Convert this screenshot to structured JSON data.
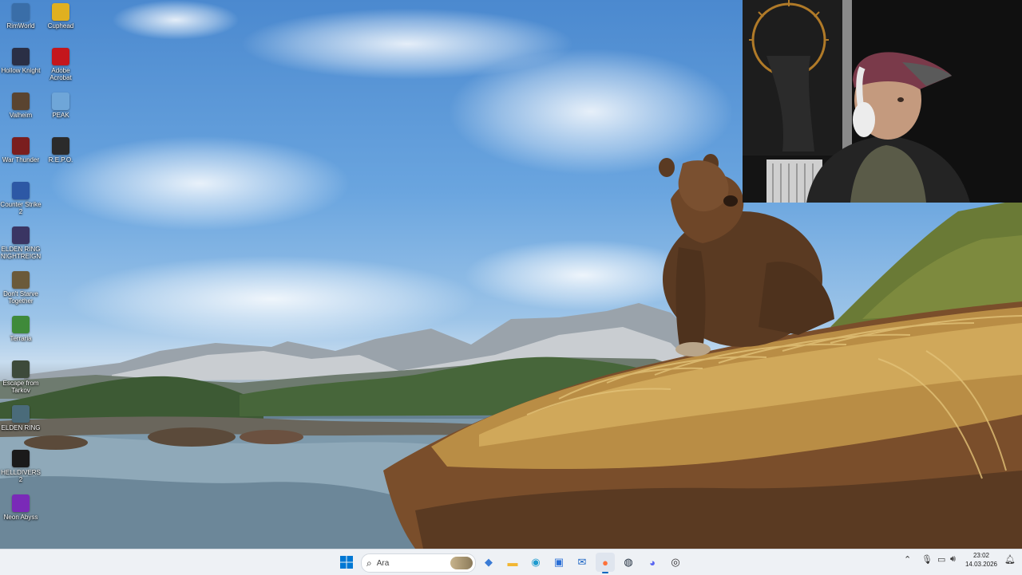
{
  "desktop_icons": [
    {
      "label": "RimWorld",
      "icon": "rimworld-icon",
      "color": "#3a6ea8"
    },
    {
      "label": "Cuphead",
      "icon": "cuphead-icon",
      "color": "#e0b020"
    },
    {
      "label": "Hollow Knight",
      "icon": "hollow-knight-icon",
      "color": "#2a2f45"
    },
    {
      "label": "Adobe Acrobat",
      "icon": "acrobat-icon",
      "color": "#c4161c"
    },
    {
      "label": "Valheim",
      "icon": "valheim-icon",
      "color": "#5a4430"
    },
    {
      "label": "PEAK",
      "icon": "peak-icon",
      "color": "#6fa6d8"
    },
    {
      "label": "War Thunder",
      "icon": "war-thunder-icon",
      "color": "#7a1e1e"
    },
    {
      "label": "R.E.P.O.",
      "icon": "repo-icon",
      "color": "#2b2b2b"
    },
    {
      "label": "Counter Strike 2",
      "icon": "cs2-icon",
      "color": "#2d58a5"
    },
    {
      "label": "ELDEN RING NIGHTREIGN",
      "icon": "nightreign-icon",
      "color": "#3a3563"
    },
    {
      "label": "Don't Starve Together",
      "icon": "dont-starve-icon",
      "color": "#6b5a3a"
    },
    {
      "label": "Terraria",
      "icon": "terraria-icon",
      "color": "#3f8a3a"
    },
    {
      "label": "Escape from Tarkov",
      "icon": "tarkov-icon",
      "color": "#3d4a3a"
    },
    {
      "label": "ELDEN RING",
      "icon": "elden-ring-icon",
      "color": "#4a6b7a"
    },
    {
      "label": "HELLDIVERS 2",
      "icon": "helldivers-icon",
      "color": "#1a1a1a"
    },
    {
      "label": "Neon Abyss",
      "icon": "neon-abyss-icon",
      "color": "#7a2ab8"
    }
  ],
  "taskbar": {
    "search_placeholder": "Ara",
    "apps": [
      {
        "name": "start",
        "icon": "windows-start-icon",
        "glyph": "⊞",
        "color": "#0078d4"
      },
      {
        "name": "widgets",
        "icon": "widgets-icon",
        "glyph": "◆",
        "color": "#3a7bd5"
      },
      {
        "name": "file-explorer",
        "icon": "folder-icon",
        "glyph": "▬",
        "color": "#f2b632"
      },
      {
        "name": "edge",
        "icon": "edge-icon",
        "glyph": "◉",
        "color": "#1f9bcf"
      },
      {
        "name": "store",
        "icon": "store-icon",
        "glyph": "▣",
        "color": "#2a6fd6"
      },
      {
        "name": "outlook",
        "icon": "outlook-icon",
        "glyph": "✉",
        "color": "#1b65c4"
      },
      {
        "name": "firefox",
        "icon": "firefox-icon",
        "glyph": "●",
        "color": "#ff7139"
      },
      {
        "name": "steam",
        "icon": "steam-icon",
        "glyph": "◍",
        "color": "#1b2838"
      },
      {
        "name": "discord",
        "icon": "discord-icon",
        "glyph": "◕",
        "color": "#5865f2"
      },
      {
        "name": "obs",
        "icon": "obs-icon",
        "glyph": "◎",
        "color": "#302e31"
      }
    ],
    "clock": {
      "time": "23:02",
      "date": "14.03.2026"
    }
  }
}
